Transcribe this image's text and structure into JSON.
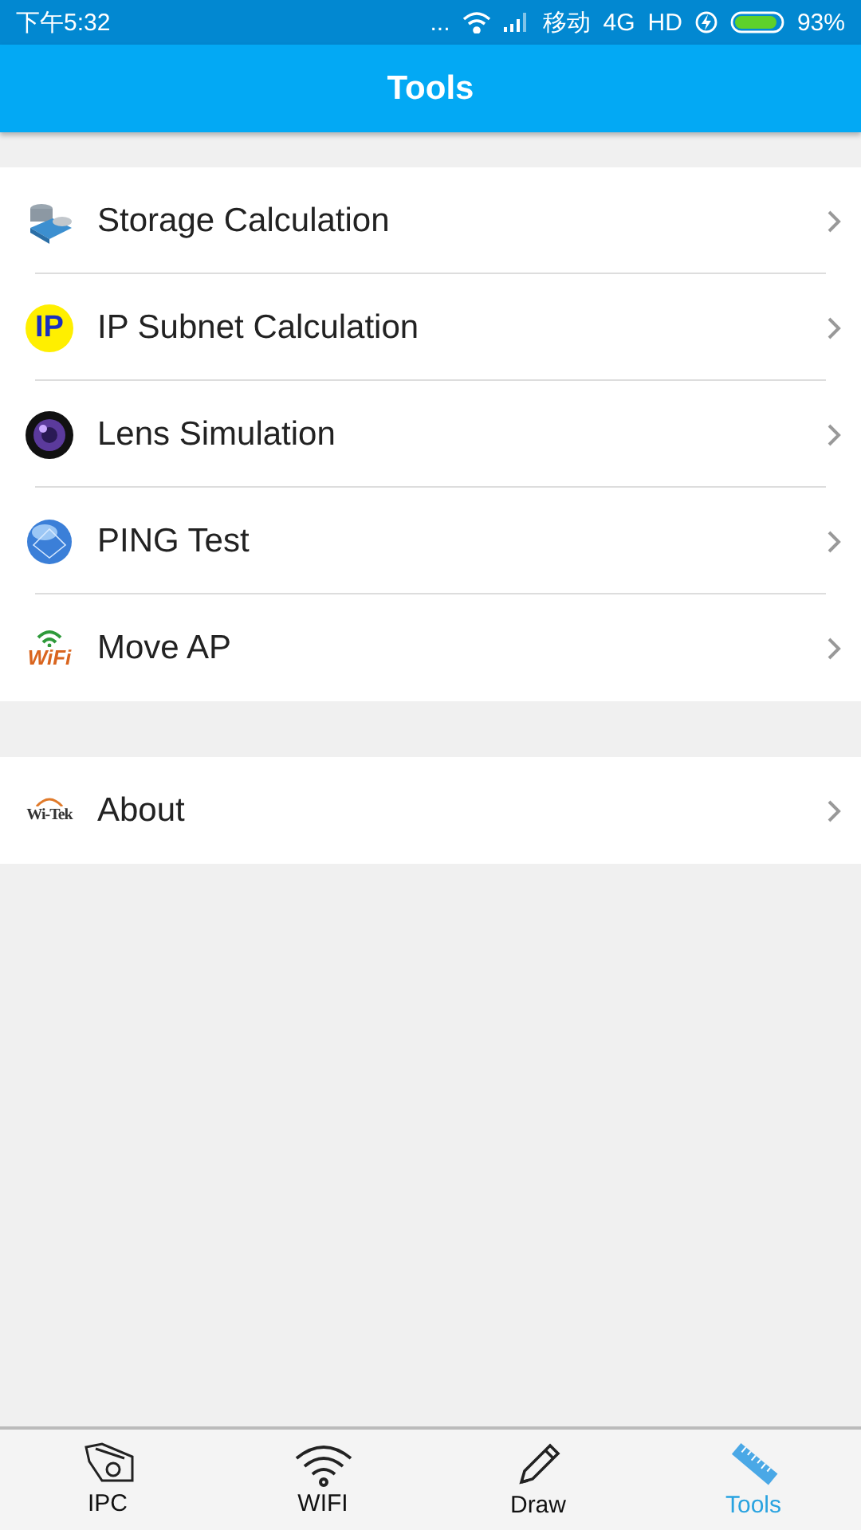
{
  "status_bar": {
    "time": "下午5:32",
    "dots": "...",
    "carrier": "移动",
    "network": "4G",
    "hd": "HD",
    "battery_percent": "93%"
  },
  "header": {
    "title": "Tools"
  },
  "groups": [
    {
      "items": [
        {
          "label": "Storage Calculation",
          "kind": "storage"
        },
        {
          "label": "IP Subnet Calculation",
          "kind": "ip",
          "icon_text": "IP"
        },
        {
          "label": "Lens Simulation",
          "kind": "lens"
        },
        {
          "label": "PING Test",
          "kind": "globe"
        },
        {
          "label": "Move AP",
          "kind": "wifi",
          "icon_text": "WiFi"
        }
      ]
    },
    {
      "items": [
        {
          "label": "About",
          "kind": "brand",
          "icon_text": "Wi-Tek"
        }
      ]
    }
  ],
  "tab_bar": [
    {
      "label": "IPC",
      "kind": "camera",
      "selected": false
    },
    {
      "label": "WIFI",
      "kind": "wifi",
      "selected": false
    },
    {
      "label": "Draw",
      "kind": "pencil",
      "selected": false
    },
    {
      "label": "Tools",
      "kind": "ruler",
      "selected": true
    }
  ]
}
